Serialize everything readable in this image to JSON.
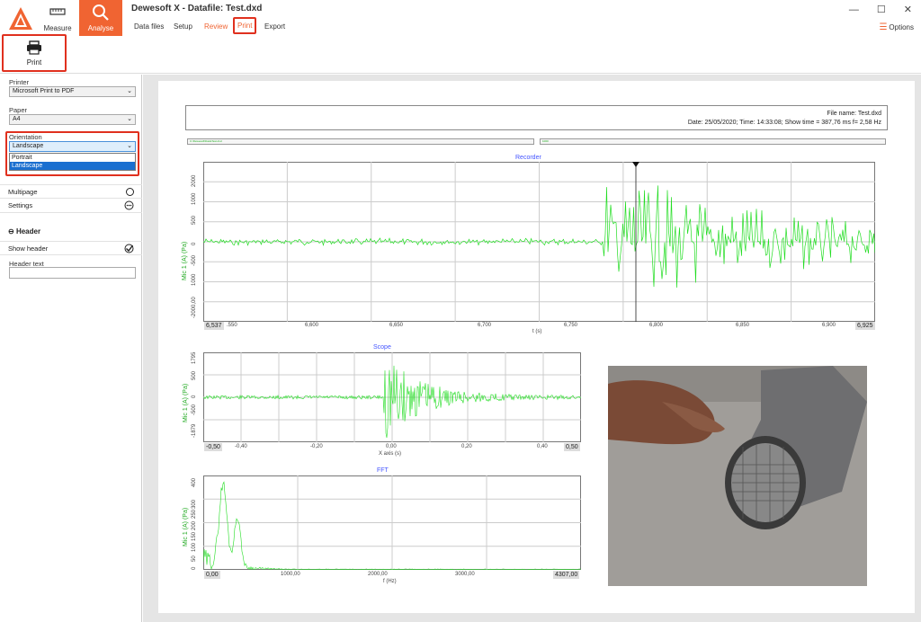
{
  "app": {
    "title": "Dewesoft X - Datafile: Test.dxd",
    "modes": {
      "measure": "Measure",
      "analyse": "Analyse"
    },
    "tabs": [
      "Data files",
      "Setup",
      "Review",
      "Print",
      "Export"
    ],
    "options_label": "Options",
    "window_controls": [
      "—",
      "☐",
      "✕"
    ]
  },
  "toolbar": {
    "print_label": "Print"
  },
  "left_panel": {
    "printer_label": "Printer",
    "printer_value": "Microsoft Print to PDF",
    "paper_label": "Paper",
    "paper_value": "A4",
    "orientation_label": "Orientation",
    "orientation_value": "Landscape",
    "orientation_options": [
      "Portrait",
      "Landscape"
    ],
    "multipage_label": "Multipage",
    "settings_label": "Settings",
    "header_section": "Header",
    "show_header_label": "Show header",
    "header_text_label": "Header text",
    "header_text_value": ""
  },
  "report": {
    "file_name_line": "File name: Test.dxd",
    "info_line": "Date: 25/05/2020; Time: 14:33:08; Show time = 387,76 ms  f= 2,58 Hz",
    "strip1": "C:\\Dewesoft\\Data\\Test.dxd",
    "strip2": "1000"
  },
  "chart_data": [
    {
      "type": "line",
      "title": "Recorder",
      "xlabel": "t (s)",
      "ylabel": "Mic 1 (A) (Pa)",
      "x_unit_label": "t (s)",
      "x_start_box": "6,537",
      "x_end_box": "6,925",
      "xticks": [
        ".550",
        "6,600",
        "6,650",
        "6,700",
        "6,750",
        "6,800",
        "6,850",
        "6,900"
      ],
      "yticks": [
        "2000",
        "1000",
        "500",
        "0",
        "-500",
        "1000",
        "-2000,00"
      ],
      "ylim": [
        -2000,
        2000
      ],
      "signal_color": "#22dd22"
    },
    {
      "type": "line",
      "title": "Scope",
      "xlabel": "X axis (s)",
      "ylabel": "Mic 1 (A) (Pa)",
      "x_unit_label": "[s]",
      "x_start_box": "-0,50",
      "x_end_box": "0,50",
      "xticks": [
        "-0,40",
        "-0,20",
        "0,00",
        "0,20",
        "0,40"
      ],
      "yticks": [
        "1795",
        "500",
        "0",
        "-500",
        "-1879"
      ],
      "ylim": [
        -1879,
        1795
      ],
      "signal_color": "#22dd22"
    },
    {
      "type": "line",
      "title": "FFT",
      "xlabel": "f (Hz)",
      "ylabel": "Mic 1 (A) (Pa)",
      "x_unit_label": "f (Hz)",
      "x_start_box": "0,00",
      "x_end_box": "4307,00",
      "xticks": [
        "1000,00",
        "2000,00",
        "3000,00"
      ],
      "yticks": [
        "400",
        "300",
        "250",
        "200",
        "150",
        "100",
        "50",
        "0"
      ],
      "ylim": [
        0,
        400
      ],
      "signal_color": "#22dd22"
    }
  ],
  "colors": {
    "accent": "#f06432",
    "highlight": "#e0301e",
    "selection": "#1a6fd0"
  }
}
